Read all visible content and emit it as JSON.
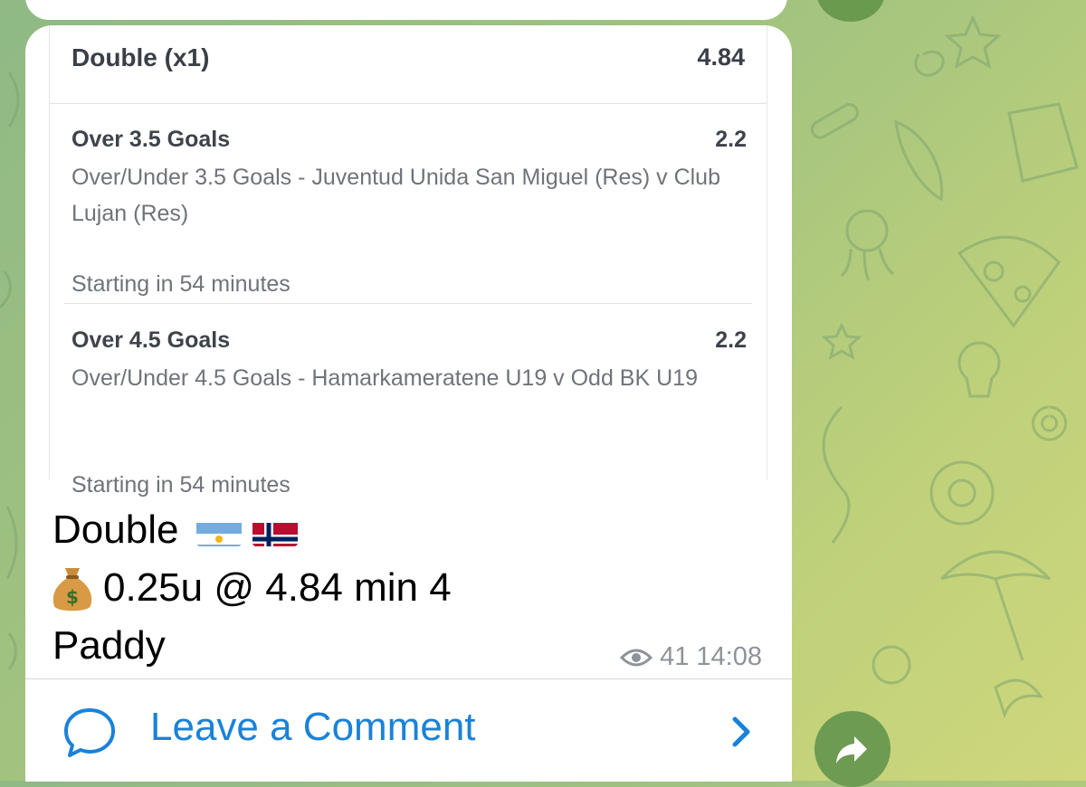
{
  "bet_card": {
    "header": {
      "label": "Double (x1)",
      "odds": "4.84"
    },
    "legs": [
      {
        "title": "Over 3.5 Goals",
        "odds": "2.2",
        "description": "Over/Under 3.5 Goals - Juventud Unida San Miguel (Res) v Club Lujan (Res)",
        "start": "Starting in 54 minutes"
      },
      {
        "title": "Over 4.5 Goals",
        "odds": "2.2",
        "description": "Over/Under 4.5 Goals - Hamarkameratene U19 v Odd BK U19",
        "start": "Starting in 54 minutes"
      }
    ]
  },
  "message": {
    "line1": "Double",
    "line2": "0.25u @ 4.84 min 4",
    "line3": "Paddy",
    "flags": [
      "flag-argentina",
      "flag-norway"
    ],
    "emoji": "money-bag"
  },
  "meta": {
    "views": "41",
    "time": "14:08"
  },
  "comments": {
    "label": "Leave a Comment"
  },
  "colors": {
    "link": "#1a82d8",
    "share_button": "#6e9b52",
    "background": "#a4c47f"
  },
  "icons": [
    "eye-icon",
    "comment-bubble-icon",
    "chevron-right-icon",
    "share-arrow-icon"
  ]
}
